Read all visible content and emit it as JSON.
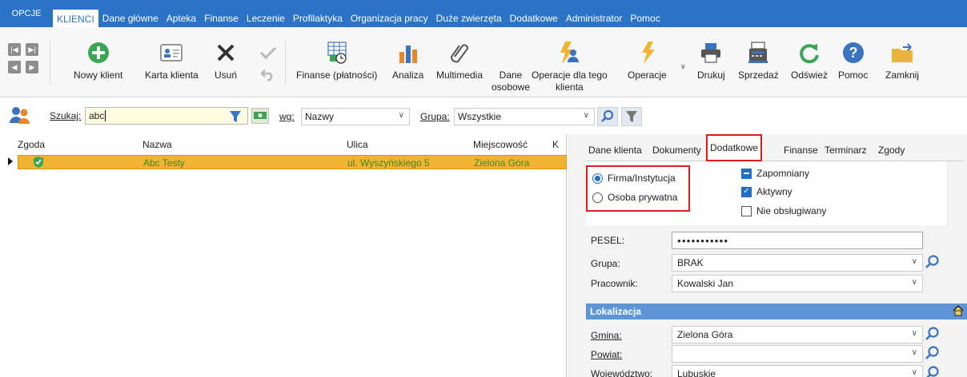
{
  "menubar": {
    "opcje": "OPCJE",
    "items": [
      "KLIENCI",
      "Dane główne",
      "Apteka",
      "Finanse",
      "Leczenie",
      "Profilaktyka",
      "Organizacja pracy",
      "Duże zwierzęta",
      "Dodatkowe",
      "Administrator",
      "Pomoc"
    ]
  },
  "toolbar": {
    "nowy_klient": "Nowy klient",
    "karta_klienta": "Karta klienta",
    "usun": "Usuń",
    "finanse": "Finanse (płatności)",
    "analiza": "Analiza",
    "multimedia_1": "Multimedia",
    "multimedia_2": "",
    "dane_osobowe_1": "Dane",
    "dane_osobowe_2": "osobowe",
    "operacje_klienta_1": "Operacje dla tego",
    "operacje_klienta_2": "klienta",
    "operacje": "Operacje",
    "drukuj": "Drukuj",
    "sprzedaz": "Sprzedaż",
    "odswiez": "Odśwież",
    "pomoc": "Pomoc",
    "zamknij": "Zamknij"
  },
  "search": {
    "szukaj_label": "Szukaj:",
    "szukaj_value": "abc",
    "wg_label": "wg:",
    "wg_value": "Nazwy",
    "grupa_label": "Grupa:",
    "grupa_value": "Wszystkie"
  },
  "grid": {
    "columns": [
      "Zgoda",
      "Nazwa",
      "Ulica",
      "Miejscowość",
      "K"
    ],
    "rows": [
      {
        "nazwa": "Abc Testy",
        "ulica": "ul. Wyszyńskiego 5",
        "miejscowosc": "Zielona Góra"
      }
    ]
  },
  "panel": {
    "tabs": [
      "Dane klienta",
      "Dokumenty",
      "Dodatkowe",
      "Finanse",
      "Terminarz",
      "Zgody"
    ],
    "active_tab": "Dodatkowe",
    "radio_firma": "Firma/Instytucja",
    "radio_osoba": "Osoba prywatna",
    "chk_zapomniany": "Zapomniany",
    "chk_aktywny": "Aktywny",
    "chk_nieobslugiwany": "Nie obsługiwany",
    "pesel_label": "PESEL:",
    "pesel_value": "●●●●●●●●●●●",
    "grupa_label": "Grupa:",
    "grupa_value": "BRAK",
    "pracownik_label": "Pracownik:",
    "pracownik_value": "Kowalski Jan",
    "lokalizacja": "Lokalizacja",
    "gmina_label": "Gmina:",
    "gmina_value": "Zielona Góra",
    "powiat_label": "Powiat:",
    "powiat_value": "",
    "wojewodztwo_label": "Województwo:",
    "wojewodztwo_value": "Lubuskie"
  },
  "colors": {
    "menubar": "#2b73c6",
    "selected_row": "#f0b432",
    "row_text": "#3a8a2a",
    "highlight": "#e01b1b",
    "lokalizacja": "#5e95d6"
  }
}
